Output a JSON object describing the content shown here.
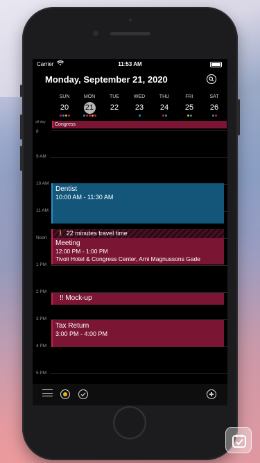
{
  "status_bar": {
    "carrier": "Carrier",
    "time": "11:53 AM"
  },
  "header": {
    "date_title": "Monday, September 21, 2020"
  },
  "week": {
    "days": [
      {
        "dow": "SUN",
        "num": "20",
        "dots": [
          "#c22350",
          "#2a8fc0",
          "#e6b413",
          "#c22350"
        ]
      },
      {
        "dow": "MON",
        "num": "21",
        "today": true,
        "dots": [
          "#2a8fc0",
          "#c22350",
          "#c22350",
          "#e6b413",
          "#c22350"
        ]
      },
      {
        "dow": "TUE",
        "num": "22",
        "dots": []
      },
      {
        "dow": "WED",
        "num": "23",
        "dots": [
          "#2a8fc0"
        ]
      },
      {
        "dow": "THU",
        "num": "24",
        "dots": [
          "#c22350",
          "#2a8fc0"
        ]
      },
      {
        "dow": "FRI",
        "num": "25",
        "dots": [
          "#e6b413",
          "#2a8fc0"
        ]
      },
      {
        "dow": "SAT",
        "num": "26",
        "dots": [
          "#2a8fc0",
          "#c22350"
        ]
      }
    ]
  },
  "all_day": {
    "label": "all-day",
    "event": "Congress"
  },
  "hours": [
    "9 AM",
    "10 AM",
    "11 AM",
    "Noon",
    "1 PM",
    "2 PM",
    "3 PM",
    "4 PM",
    "5 PM"
  ],
  "events": {
    "dentist": {
      "title": "Dentist",
      "time": "10:00 AM - 11:30 AM"
    },
    "travel": {
      "text": "22 minutes travel time"
    },
    "meeting": {
      "title": "Meeting",
      "time": "12:00 PM - 1:00 PM",
      "location": "Tivoli Hotel & Congress Center, Arni Magnussons Gade"
    },
    "mockup": {
      "title": "!! Mock-up"
    },
    "tax": {
      "title": "Tax Return",
      "time": "3:00 PM - 4:00 PM"
    }
  },
  "toolbar": {
    "icons": [
      "menu-icon",
      "today-icon",
      "checkmark-icon",
      "add-icon"
    ]
  },
  "colors": {
    "event_red": "#7a1534",
    "event_blue": "#13567a",
    "today_yellow": "#e6b413"
  }
}
